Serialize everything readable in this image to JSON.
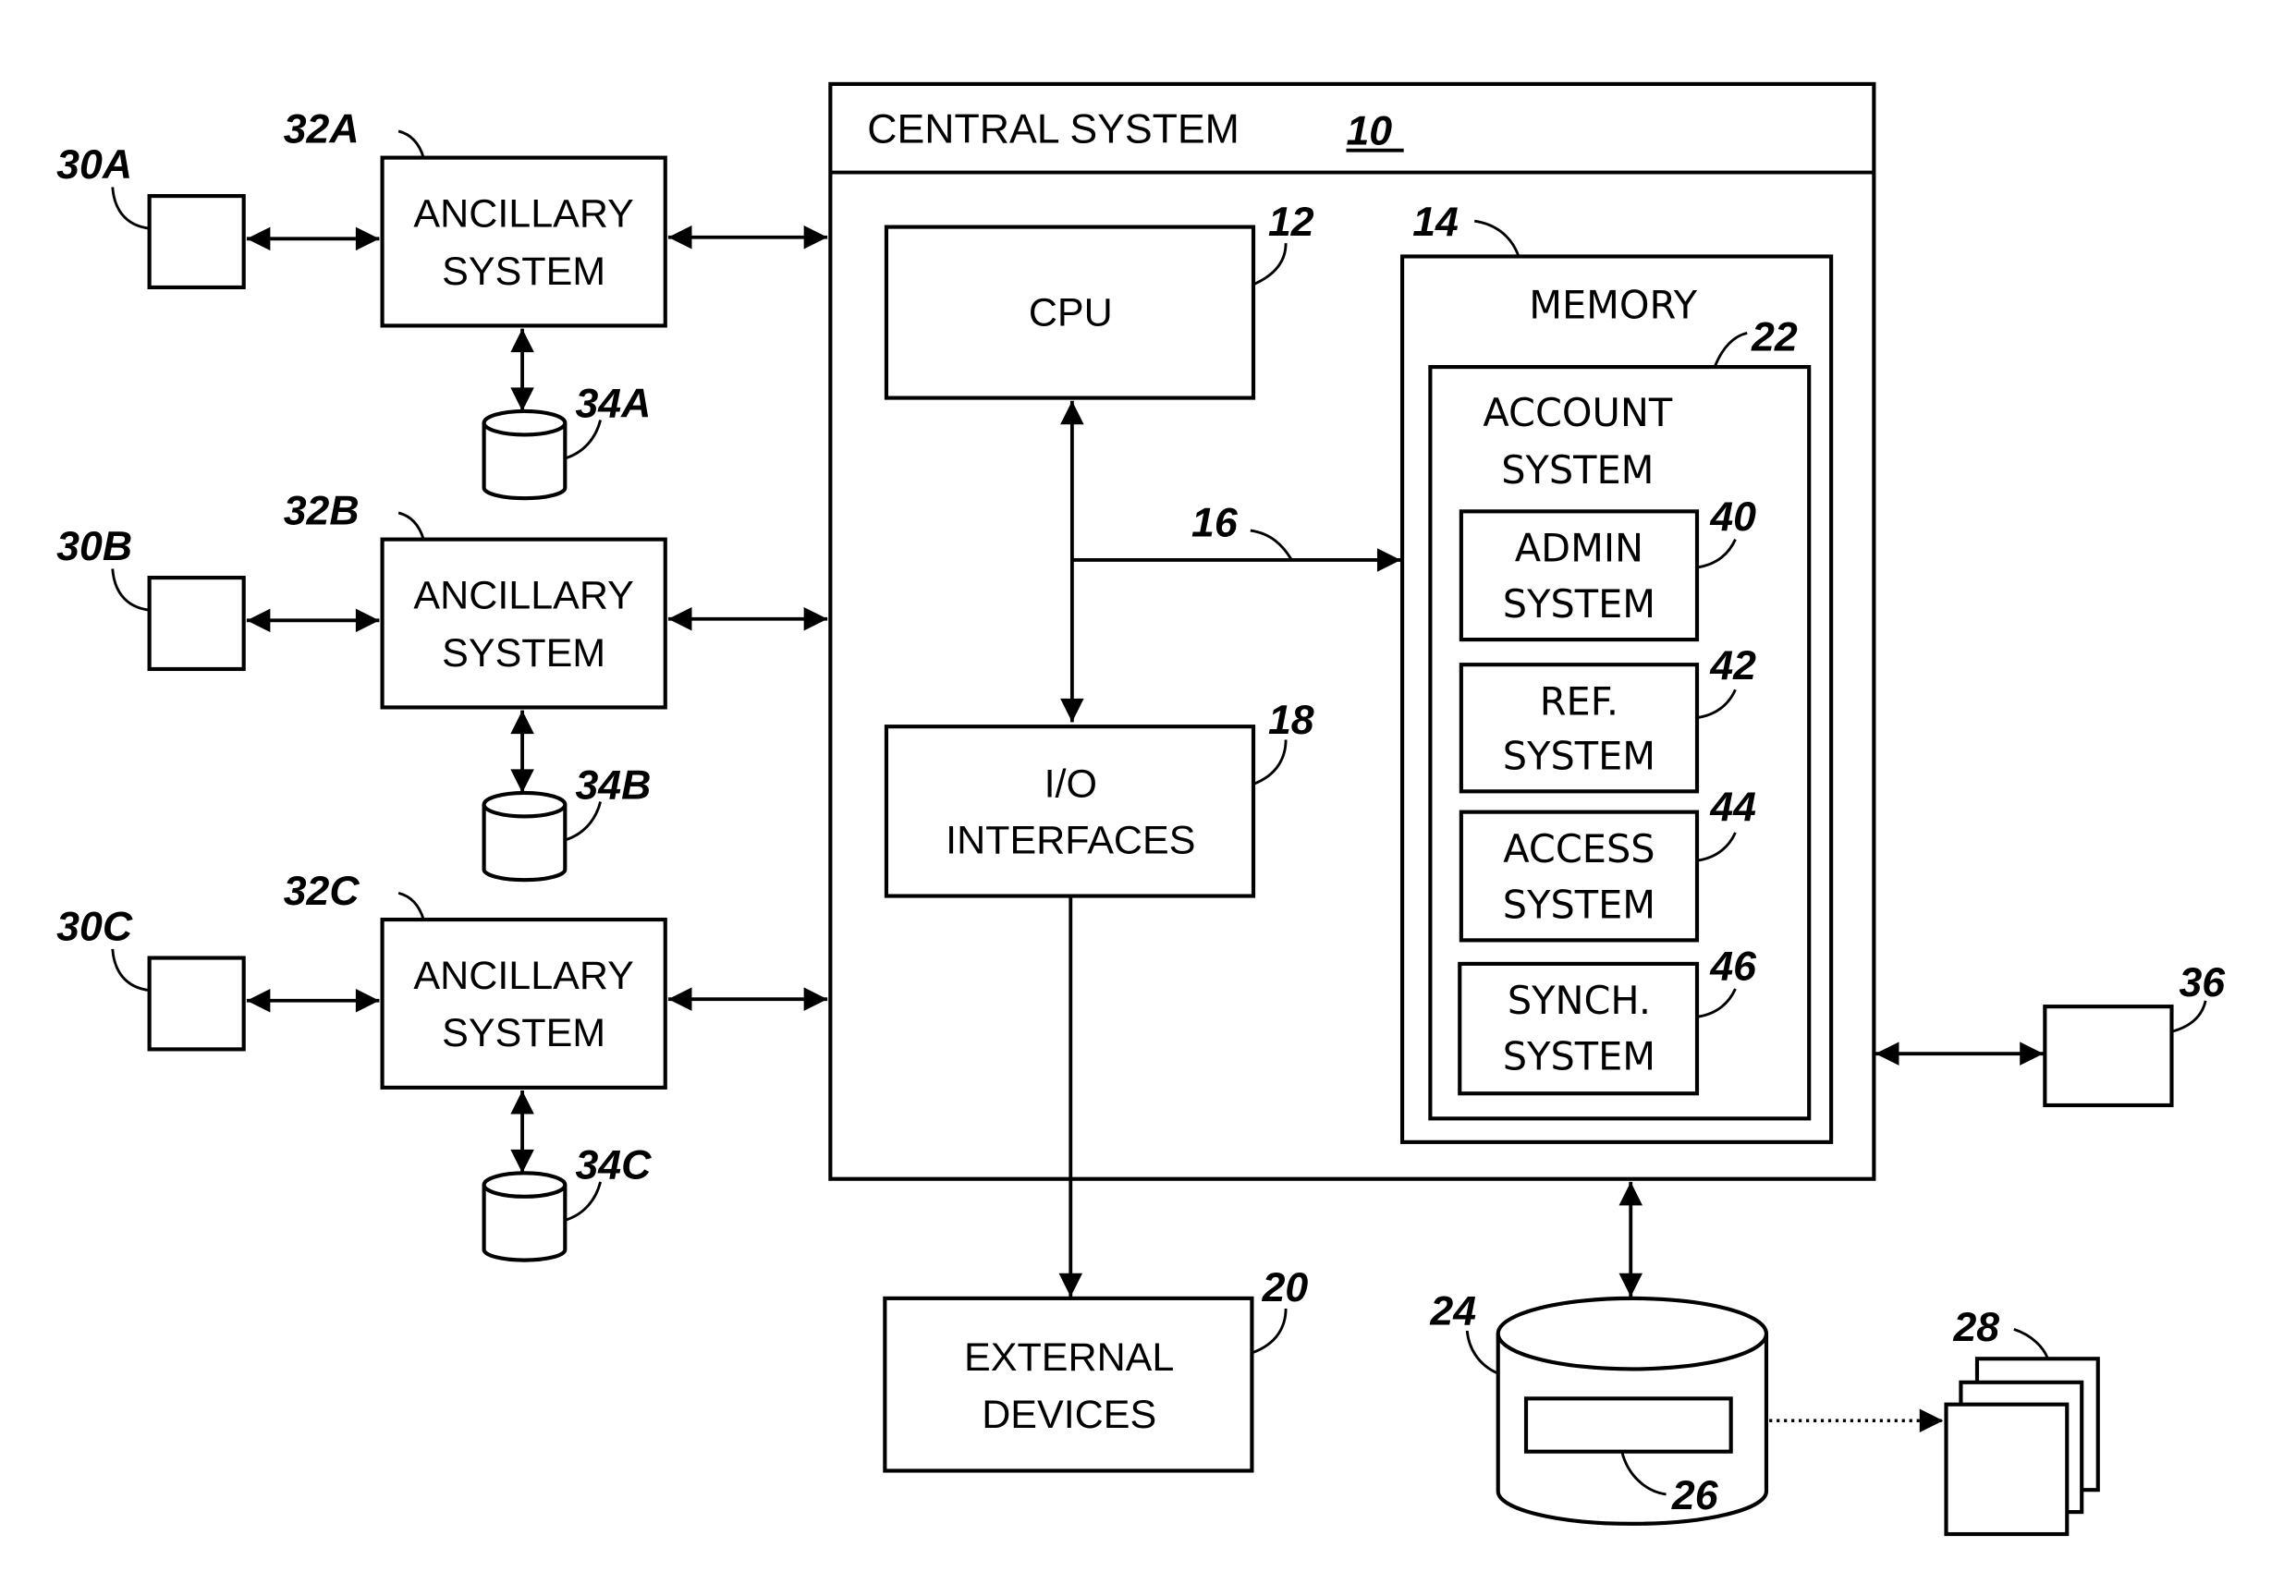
{
  "central_system": {
    "label": "CENTRAL SYSTEM",
    "ref": "10"
  },
  "cpu": {
    "label": "CPU",
    "ref": "12"
  },
  "memory": {
    "label": "MEMORY",
    "ref": "14"
  },
  "bus": {
    "ref": "16"
  },
  "io": {
    "line1": "I/O",
    "line2": "INTERFACES",
    "ref": "18"
  },
  "external": {
    "line1": "EXTERNAL",
    "line2": "DEVICES",
    "ref": "20"
  },
  "account": {
    "line1": "ACCOUNT",
    "line2": "SYSTEM",
    "ref": "22"
  },
  "subsystems": [
    {
      "line1": "ADMIN",
      "line2": "SYSTEM",
      "ref": "40"
    },
    {
      "line1": "REF.",
      "line2": "SYSTEM",
      "ref": "42"
    },
    {
      "line1": "ACCESS",
      "line2": "SYSTEM",
      "ref": "44"
    },
    {
      "line1": "SYNCH.",
      "line2": "SYSTEM",
      "ref": "46"
    }
  ],
  "ancillary": [
    {
      "line1": "ANCILLARY",
      "line2": "SYSTEM",
      "ref": "32A",
      "device_ref": "30A",
      "db_ref": "34A"
    },
    {
      "line1": "ANCILLARY",
      "line2": "SYSTEM",
      "ref": "32B",
      "device_ref": "30B",
      "db_ref": "34B"
    },
    {
      "line1": "ANCILLARY",
      "line2": "SYSTEM",
      "ref": "32C",
      "device_ref": "30C",
      "db_ref": "34C"
    }
  ],
  "storage": {
    "ref": "24",
    "record_ref": "26"
  },
  "documents": {
    "ref": "28"
  },
  "device36": {
    "ref": "36"
  }
}
